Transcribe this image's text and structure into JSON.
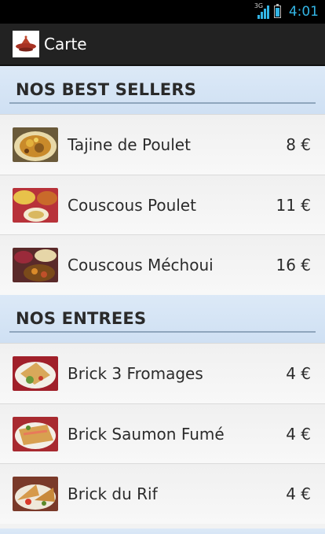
{
  "status_bar": {
    "network": "3G",
    "time": "4:01"
  },
  "action_bar": {
    "title": "Carte",
    "icon": "tajine-logo-icon"
  },
  "sections": [
    {
      "title": "NOS BEST SELLERS",
      "items": [
        {
          "name": "Tajine de Poulet",
          "price": "8 €"
        },
        {
          "name": "Couscous Poulet",
          "price": "11 €"
        },
        {
          "name": "Couscous Méchoui",
          "price": "16 €"
        }
      ]
    },
    {
      "title": "NOS ENTREES",
      "items": [
        {
          "name": "Brick 3 Fromages",
          "price": "4 €"
        },
        {
          "name": "Brick Saumon Fumé",
          "price": "4 €"
        },
        {
          "name": "Brick du Rif",
          "price": "4 €"
        }
      ]
    }
  ],
  "colors": {
    "status_accent": "#33b5e5",
    "action_bar": "#222222",
    "section_header": "#d6e5f5"
  }
}
